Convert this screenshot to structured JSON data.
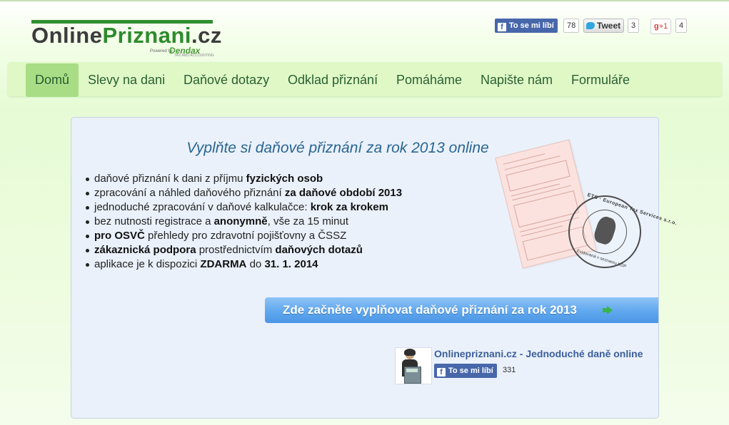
{
  "logo": {
    "part1": "Online",
    "part2": "Priznani",
    "part3": ".cz",
    "powered": "Powered by",
    "brand": "Dendax",
    "brand_sub": "TAX AND ACCOUNTING"
  },
  "social": {
    "facebook": {
      "label": "To se mi líbí",
      "count": "78"
    },
    "twitter": {
      "label": "Tweet",
      "count": "3"
    },
    "gplus": {
      "label": "+1",
      "count": "4"
    }
  },
  "nav": {
    "items": [
      {
        "label": "Domů",
        "active": true
      },
      {
        "label": "Slevy na dani"
      },
      {
        "label": "Daňové dotazy"
      },
      {
        "label": "Odklad přiznání"
      },
      {
        "label": "Pomáháme"
      },
      {
        "label": "Napište nám"
      },
      {
        "label": "Formuláře"
      }
    ]
  },
  "main": {
    "headline": "Vyplňte si daňové přiznání za rok 2013 online",
    "features": [
      [
        {
          "t": "daňové přiznání k dani z příjmu "
        },
        {
          "t": "fyzických osob",
          "b": true
        }
      ],
      [
        {
          "t": "zpracování a náhled daňového přiznání "
        },
        {
          "t": "za daňové období 2013",
          "b": true
        }
      ],
      [
        {
          "t": "jednoduché zpracování v daňové kalkulačce: "
        },
        {
          "t": "krok za krokem",
          "b": true
        }
      ],
      [
        {
          "t": "bez nutnosti registrace a "
        },
        {
          "t": "anonymně",
          "b": true
        },
        {
          "t": ", vše za 15 minut"
        }
      ],
      [
        {
          "t": "pro OSVČ",
          "b": true
        },
        {
          "t": " přehledy pro zdravotní pojišťovny a ČSSZ"
        }
      ],
      [
        {
          "t": "zákaznická podpora",
          "b": true
        },
        {
          "t": " prostřednictvím "
        },
        {
          "t": "daňových dotazů",
          "b": true
        }
      ],
      [
        {
          "t": "aplikace je k dispozici "
        },
        {
          "t": "ZDARMA",
          "b": true
        },
        {
          "t": " do "
        },
        {
          "t": "31. 1. 2014",
          "b": true
        }
      ]
    ],
    "cta_label": "Zde začněte vyplňovat daňové přiznání za rok 2013",
    "stamp_top": "ETS · European Tax Services s.r.o.",
    "stamp_bottom": "Evidovaná v seznamu KDP"
  },
  "fb_page": {
    "name": "Onlinepriznani.cz - Jednoduché daně online",
    "like_label": "To se mi líbí",
    "count": "331"
  },
  "colors": {
    "nav_bg": "#dff8c6",
    "nav_active": "#a8dd85",
    "nav_text": "#27602a",
    "headline": "#2a6591",
    "cta": "#5fa7ee",
    "facebook": "#4867aa"
  }
}
